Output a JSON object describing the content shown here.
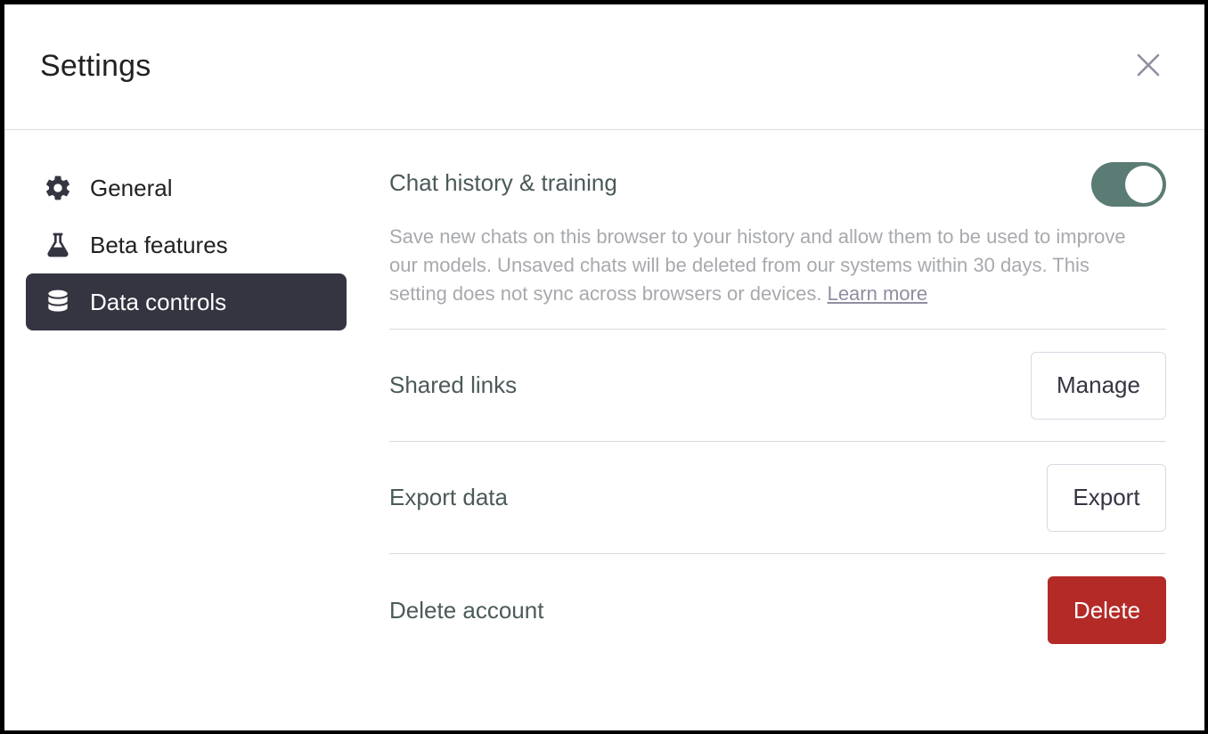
{
  "dialog": {
    "title": "Settings",
    "close_icon": "close-icon"
  },
  "sidebar": {
    "items": [
      {
        "label": "General",
        "icon": "gear-icon",
        "active": false
      },
      {
        "label": "Beta features",
        "icon": "flask-icon",
        "active": false
      },
      {
        "label": "Data controls",
        "icon": "database-icon",
        "active": true
      }
    ]
  },
  "data_controls": {
    "chat_history": {
      "label": "Chat history & training",
      "enabled": true,
      "description": "Save new chats on this browser to your history and allow them to be used to improve our models. Unsaved chats will be deleted from our systems within 30 days. This setting does not sync across browsers or devices.",
      "learn_more": "Learn more"
    },
    "shared_links": {
      "label": "Shared links",
      "button": "Manage"
    },
    "export_data": {
      "label": "Export data",
      "button": "Export"
    },
    "delete_account": {
      "label": "Delete account",
      "button": "Delete"
    }
  },
  "colors": {
    "toggle_on": "#5b7c75",
    "active_nav": "#343541",
    "danger": "#b42a26"
  }
}
